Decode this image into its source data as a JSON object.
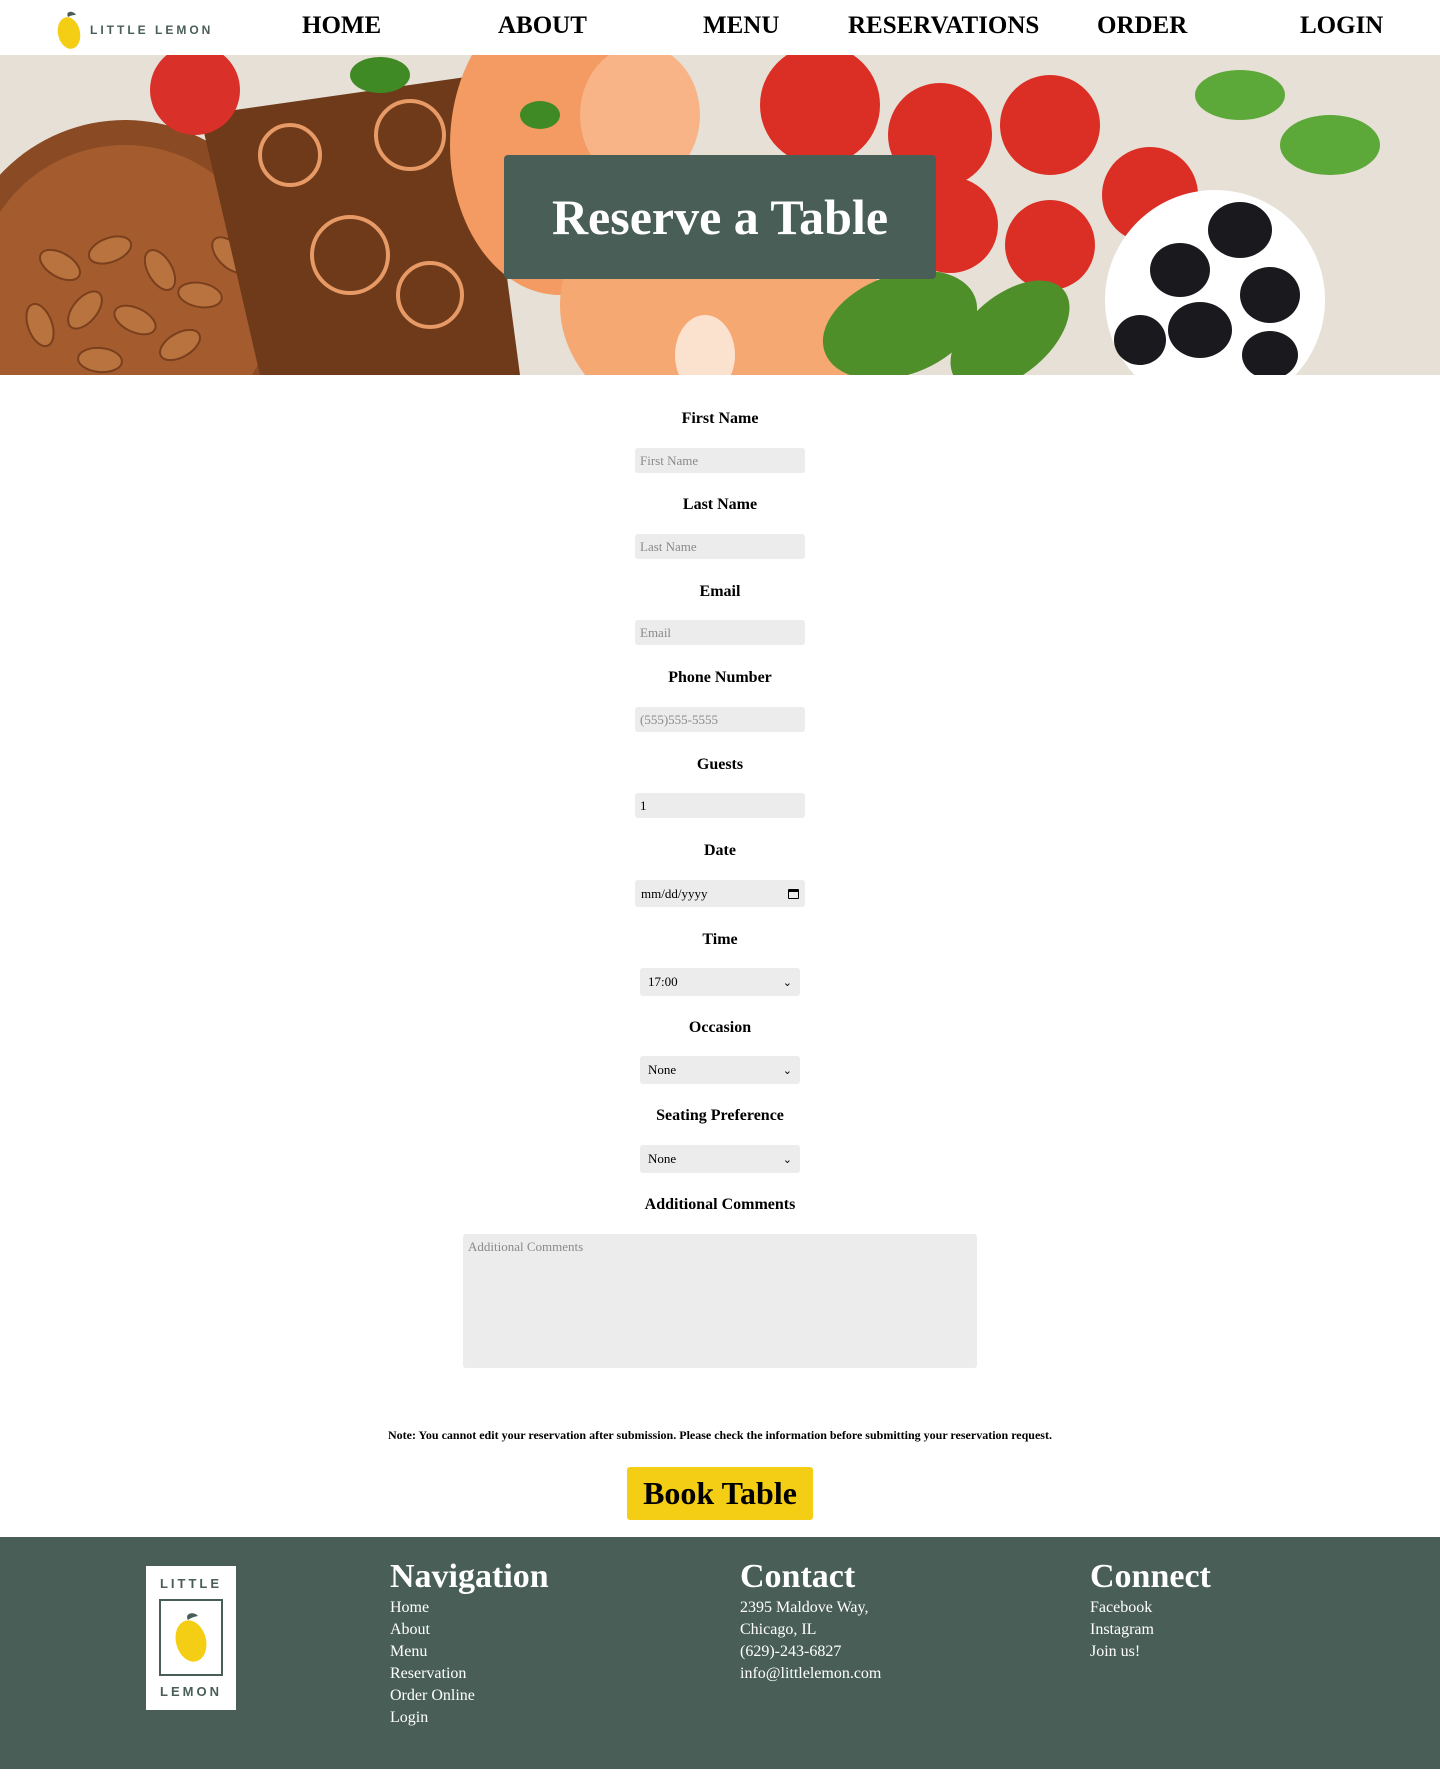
{
  "brand": {
    "logo_text": "LITTLE LEMON"
  },
  "nav": [
    {
      "label": "HOME"
    },
    {
      "label": "ABOUT"
    },
    {
      "label": "MENU"
    },
    {
      "label": "RESERVATIONS"
    },
    {
      "label": "ORDER"
    },
    {
      "label": "LOGIN"
    }
  ],
  "hero": {
    "title": "Reserve a Table"
  },
  "form": {
    "first_name": {
      "label": "First Name",
      "placeholder": "First Name"
    },
    "last_name": {
      "label": "Last Name",
      "placeholder": "Last Name"
    },
    "email": {
      "label": "Email",
      "placeholder": "Email"
    },
    "phone": {
      "label": "Phone Number",
      "placeholder": "(555)555-5555"
    },
    "guests": {
      "label": "Guests",
      "value": "1"
    },
    "date": {
      "label": "Date",
      "value": "mm/dd/yyyy"
    },
    "time": {
      "label": "Time",
      "value": "17:00"
    },
    "occasion": {
      "label": "Occasion",
      "value": "None"
    },
    "seating": {
      "label": "Seating Preference",
      "value": "None"
    },
    "comments": {
      "label": "Additional Comments",
      "placeholder": "Additional Comments"
    },
    "note": "Note: You cannot edit your reservation after submission. Please check the information before submitting your reservation request.",
    "submit_label": "Book Table"
  },
  "footer": {
    "logo_top": "LITTLE",
    "logo_bottom": "LEMON",
    "navigation": {
      "heading": "Navigation",
      "links": [
        "Home",
        "About",
        "Menu",
        "Reservation",
        "Order Online",
        "Login"
      ]
    },
    "contact": {
      "heading": "Contact",
      "lines": [
        "2395 Maldove Way,",
        "Chicago, IL",
        "(629)-243-6827",
        "info@littlelemon.com"
      ]
    },
    "connect": {
      "heading": "Connect",
      "links": [
        "Facebook",
        "Instagram",
        "Join us!"
      ]
    }
  },
  "colors": {
    "primary": "#495e57",
    "accent": "#f4ce14",
    "input_bg": "#ececec"
  }
}
